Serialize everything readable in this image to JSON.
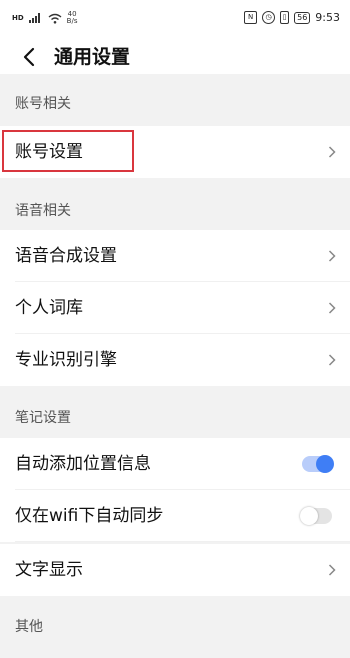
{
  "status_bar": {
    "net_type": "HD",
    "net_speed_value": "40",
    "net_speed_unit": "B/s",
    "battery": "56",
    "time": "9:53"
  },
  "header": {
    "title": "通用设置"
  },
  "sections": [
    {
      "title": "账号相关",
      "rows": [
        {
          "label": "账号设置",
          "control": "chevron",
          "highlighted": true
        }
      ]
    },
    {
      "title": "语音相关",
      "rows": [
        {
          "label": "语音合成设置",
          "control": "chevron"
        },
        {
          "label": "个人词库",
          "control": "chevron"
        },
        {
          "label": "专业识别引擎",
          "control": "chevron"
        }
      ]
    },
    {
      "title": "笔记设置",
      "rows": [
        {
          "label": "自动添加位置信息",
          "control": "toggle",
          "on": true
        },
        {
          "label": "仅在wifi下自动同步",
          "control": "toggle",
          "on": false
        },
        {
          "label": "文字显示",
          "control": "chevron"
        }
      ]
    },
    {
      "title": "其他",
      "rows": []
    }
  ],
  "colors": {
    "accent": "#3f7ef5",
    "highlight_box": "#d9363e",
    "background": "#f2f2f2"
  }
}
